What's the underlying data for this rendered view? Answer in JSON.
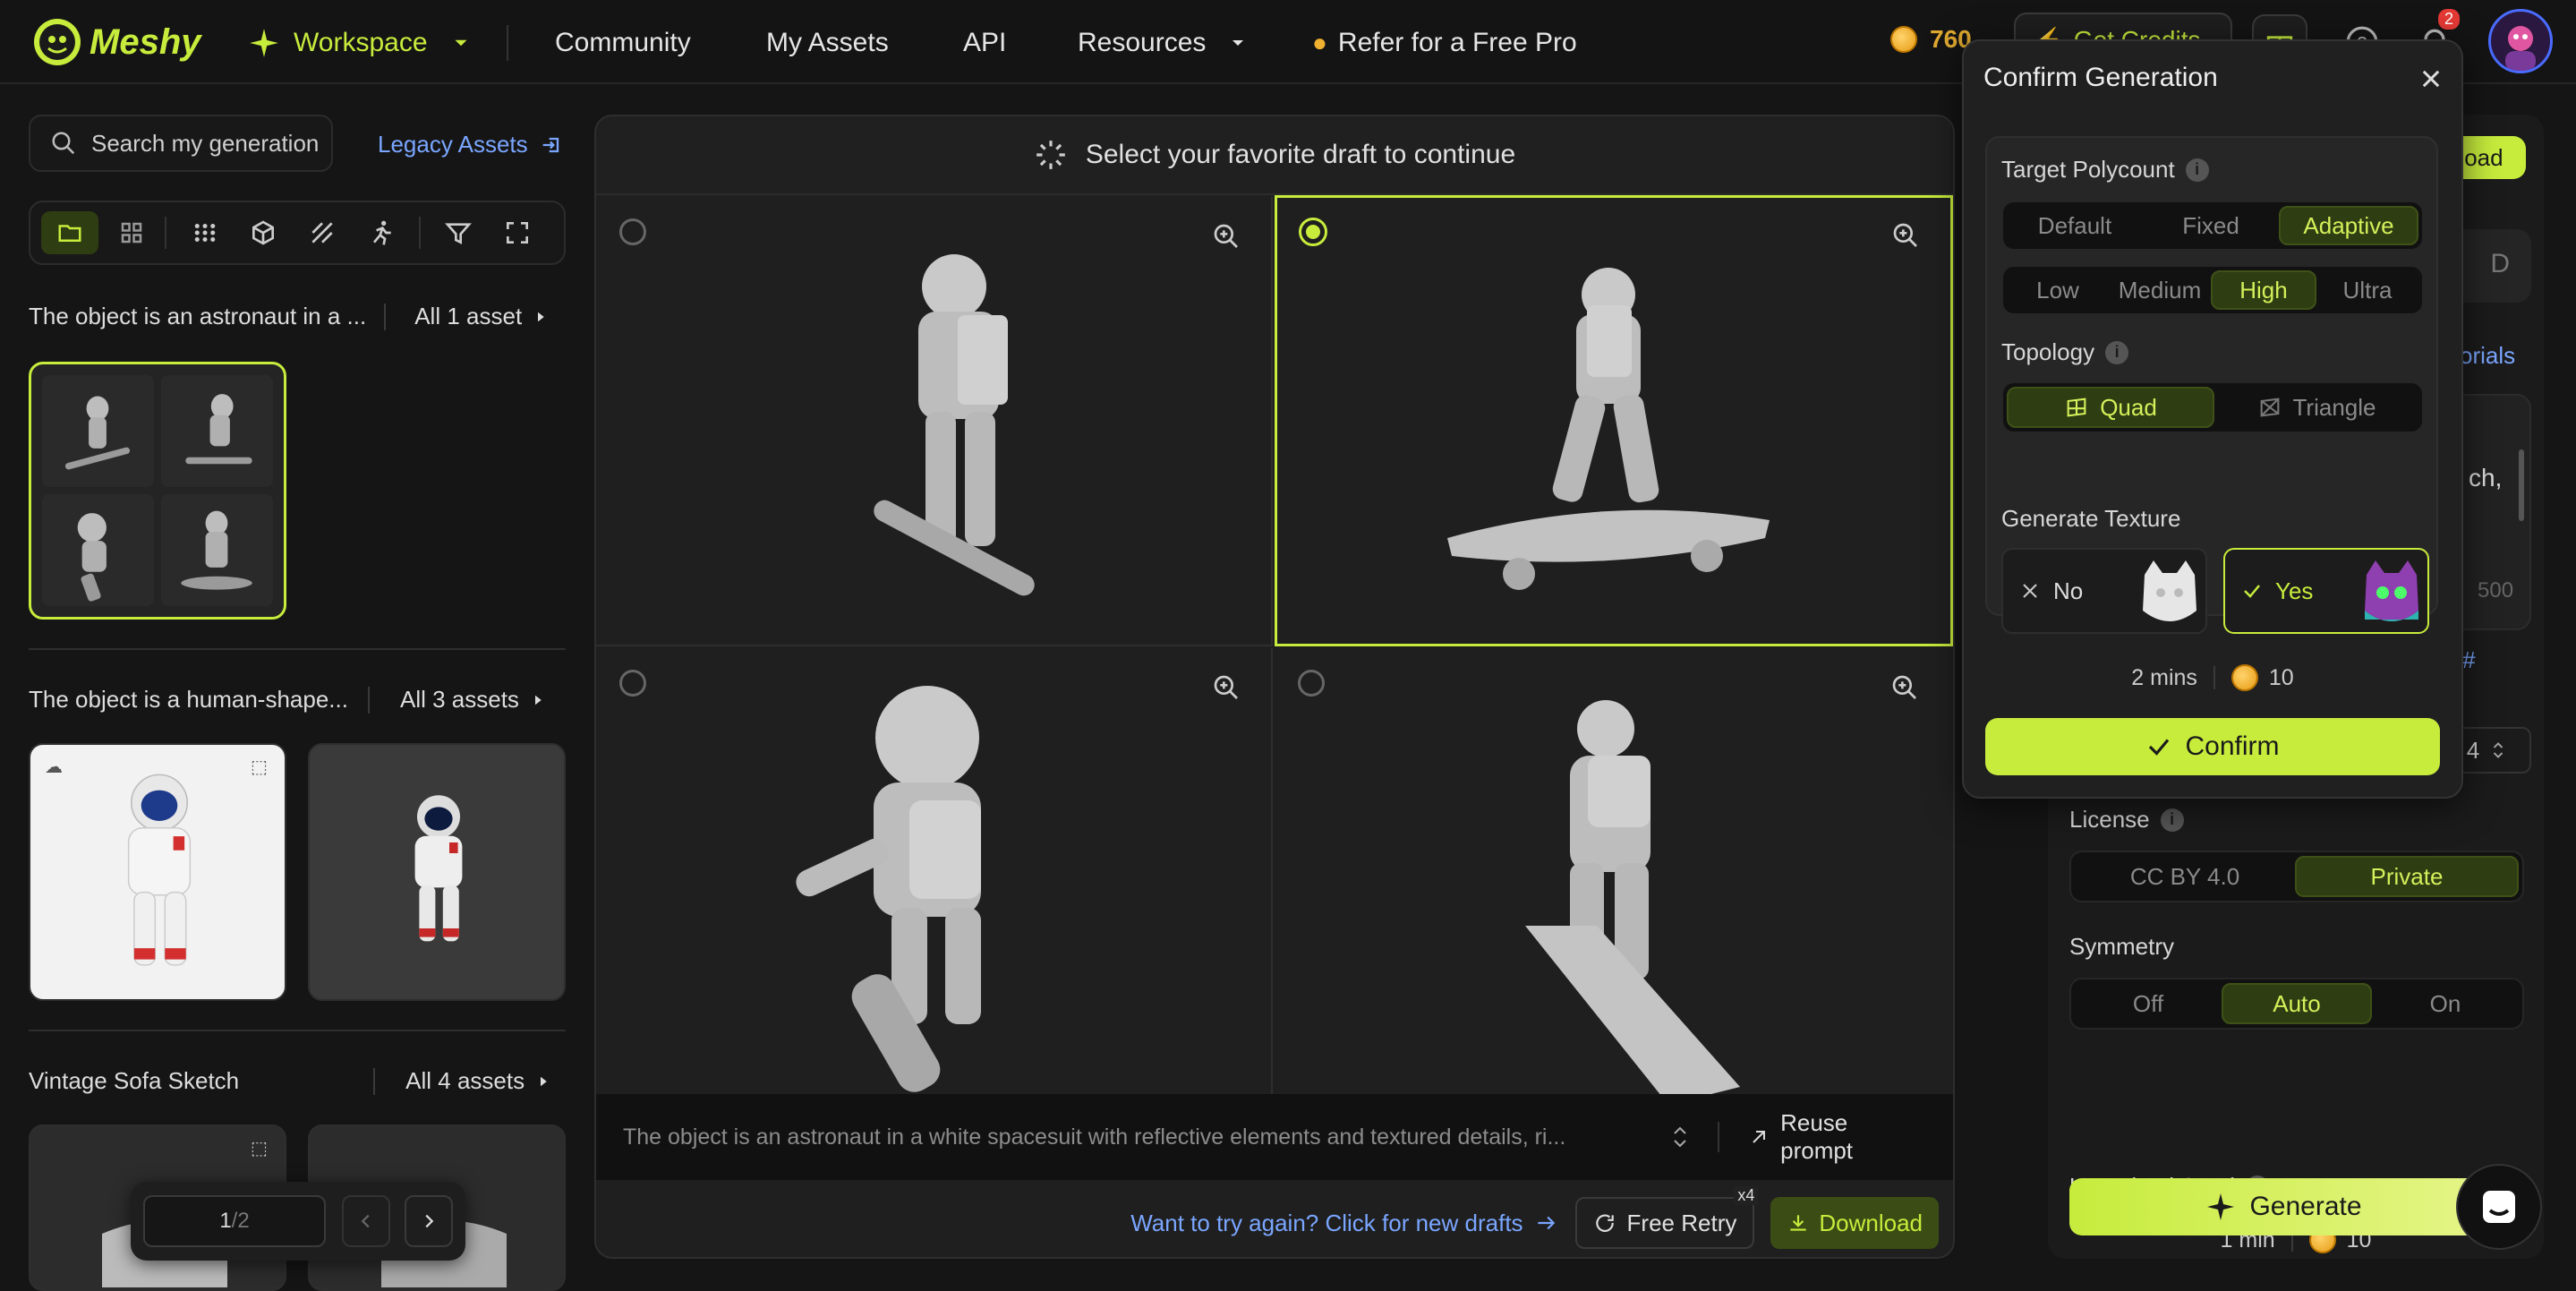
{
  "nav": {
    "logo": "Meshy",
    "workspace": "Workspace",
    "community": "Community",
    "my_assets": "My Assets",
    "api": "API",
    "resources": "Resources",
    "refer": "Refer for a Free Pro",
    "credits": "760",
    "get_credits": "Get Credits",
    "notif_count": "2"
  },
  "left": {
    "search_placeholder": "Search my generation",
    "legacy": "Legacy Assets",
    "groups": [
      {
        "title": "The object is an astronaut in a ...",
        "count": "All 1 asset"
      },
      {
        "title": "The object is a human-shape...",
        "count": "All 3 assets"
      },
      {
        "title": "Vintage Sofa Sketch",
        "count": "All 4 assets"
      }
    ],
    "pager": {
      "page": "1",
      "total": "/2"
    }
  },
  "center": {
    "header": "Select your favorite draft to continue",
    "prompt": "The object is an astronaut in a white spacesuit with reflective elements and textured details, ri...",
    "reuse": "Reuse prompt",
    "retry_text": "Want to try again? Click for new drafts",
    "free_retry": "Free Retry",
    "retry_badge": "x4",
    "download": "Download"
  },
  "right": {
    "upload": "load",
    "d_letter": "D",
    "tutorials": "orials",
    "text_frag": "ch,",
    "count_frag": "500",
    "link_frag": "re#",
    "stepper_val": "4",
    "license_label": "License",
    "license_options": [
      "CC BY 4.0",
      "Private"
    ],
    "license_selected": "Private",
    "symmetry_label": "Symmetry",
    "symmetry_options": [
      "Off",
      "Auto",
      "On"
    ],
    "symmetry_selected": "Auto",
    "seed_label": "Use Fixed Seed",
    "time": "1 min",
    "cost": "10",
    "generate": "Generate"
  },
  "modal": {
    "title": "Confirm Generation",
    "polycount_label": "Target Polycount",
    "poly_mode": [
      "Default",
      "Fixed",
      "Adaptive"
    ],
    "poly_mode_selected": "Adaptive",
    "poly_level": [
      "Low",
      "Medium",
      "High",
      "Ultra"
    ],
    "poly_level_selected": "High",
    "topology_label": "Topology",
    "topology": [
      "Quad",
      "Triangle"
    ],
    "topology_selected": "Quad",
    "texture_label": "Generate Texture",
    "texture_no": "No",
    "texture_yes": "Yes",
    "texture_selected": "Yes",
    "time": "2 mins",
    "cost": "10",
    "confirm": "Confirm"
  },
  "colors": {
    "accent": "#c7ec3c",
    "background": "#151515"
  }
}
